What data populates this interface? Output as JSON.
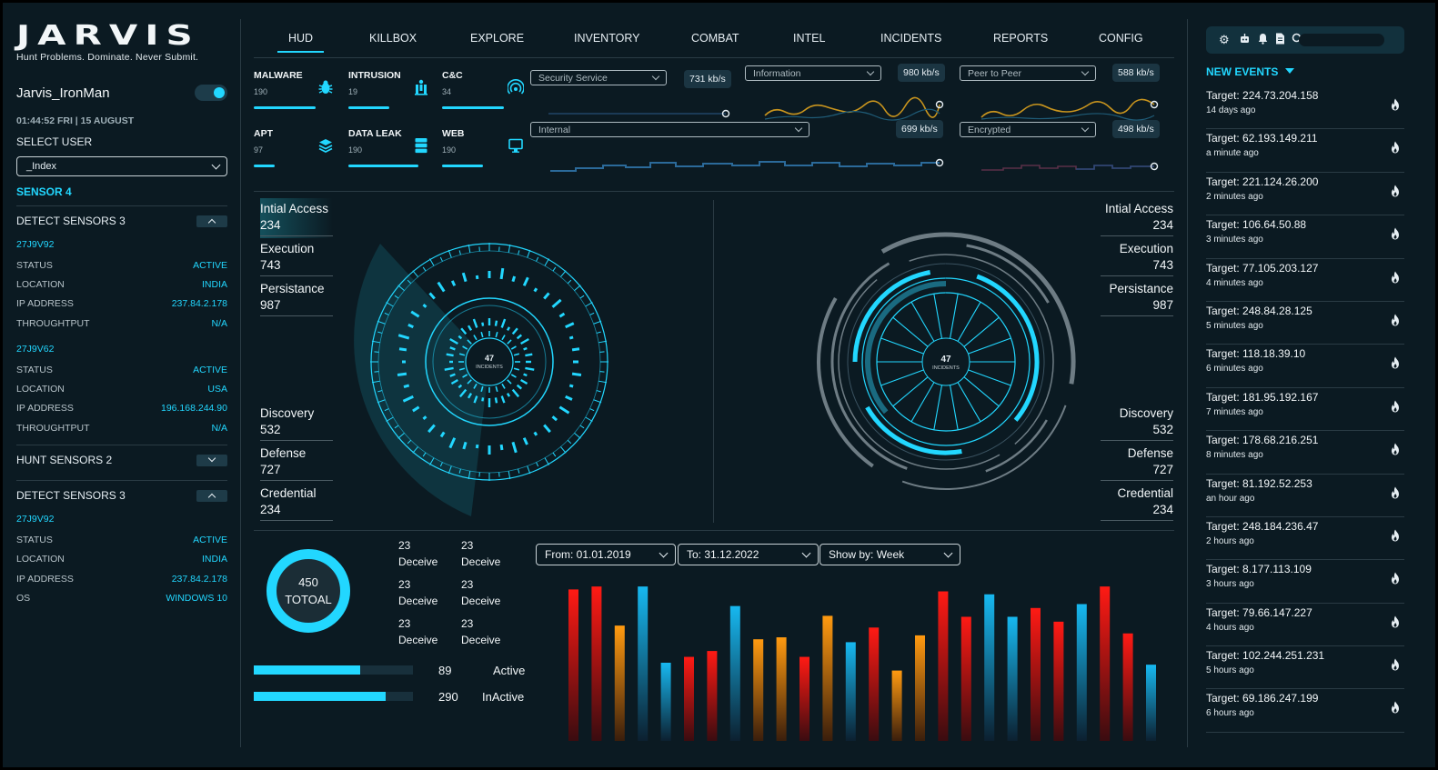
{
  "app": {
    "logo": "JARVIS",
    "tagline": "Hunt Problems. Dominate. Never Submit."
  },
  "user": {
    "name": "Jarvis_IronMan",
    "datetime": "01:44:52 FRI | 15 AUGUST",
    "select_label": "SELECT USER",
    "select_value": "_Index"
  },
  "sidebar": {
    "sensor_title": "SENSOR 4",
    "sections": [
      {
        "title": "DETECT SENSORS 3",
        "sensors": [
          {
            "id": "27J9V92",
            "rows": [
              {
                "k": "STATUS",
                "v": "ACTIVE"
              },
              {
                "k": "LOCATION",
                "v": "INDIA"
              },
              {
                "k": "IP ADDRESS",
                "v": "237.84.2.178"
              },
              {
                "k": "THROUGHTPUT",
                "v": "N/A"
              }
            ]
          },
          {
            "id": "27J9V62",
            "rows": [
              {
                "k": "STATUS",
                "v": "ACTIVE"
              },
              {
                "k": "LOCATION",
                "v": "USA"
              },
              {
                "k": "IP ADDRESS",
                "v": "196.168.244.90"
              },
              {
                "k": "THROUGHTPUT",
                "v": "N/A"
              }
            ]
          }
        ]
      },
      {
        "title": "HUNT SENSORS 2"
      },
      {
        "title": "DETECT SENSORS 3",
        "sensors": [
          {
            "id": "27J9V92",
            "rows": [
              {
                "k": "STATUS",
                "v": "ACTIVE"
              },
              {
                "k": "LOCATION",
                "v": "INDIA"
              },
              {
                "k": "IP ADDRESS",
                "v": "237.84.2.178"
              },
              {
                "k": "OS",
                "v": "WINDOWS 10"
              }
            ]
          }
        ]
      }
    ]
  },
  "nav": [
    "HUD",
    "KILLBOX",
    "EXPLORE",
    "INVENTORY",
    "COMBAT",
    "INTEL",
    "INCIDENTS",
    "REPORTS",
    "CONFIG"
  ],
  "threats": [
    {
      "name": "MALWARE",
      "count": "190",
      "icon": "bug-icon",
      "level": 0.75
    },
    {
      "name": "INTRUSION",
      "count": "19",
      "icon": "intrusion-icon",
      "level": 0.5
    },
    {
      "name": "C&C",
      "count": "34",
      "icon": "signal-icon",
      "level": 0.75
    },
    {
      "name": "APT",
      "count": "97",
      "icon": "layers-icon",
      "level": 0.25
    },
    {
      "name": "DATA LEAK",
      "count": "190",
      "icon": "database-icon",
      "level": 0.85
    },
    {
      "name": "WEB",
      "count": "190",
      "icon": "monitor-icon",
      "level": 0.5
    }
  ],
  "traffic": {
    "top": [
      {
        "label": "Security Service",
        "rate": "731 kb/s"
      },
      {
        "label": "Information",
        "rate": "980 kb/s"
      },
      {
        "label": "Peer to Peer",
        "rate": "588 kb/s"
      }
    ],
    "bottom": [
      {
        "label": "Internal",
        "rate": "699 kb/s"
      },
      {
        "label": "Encrypted",
        "rate": "498 kb/s"
      }
    ]
  },
  "tactics": {
    "top": [
      {
        "name": "Intial Access",
        "value": "234"
      },
      {
        "name": "Execution",
        "value": "743"
      },
      {
        "name": "Persistance",
        "value": "987"
      }
    ],
    "bottom": [
      {
        "name": "Discovery",
        "value": "532"
      },
      {
        "name": "Defense",
        "value": "727"
      },
      {
        "name": "Credential",
        "value": "234"
      }
    ]
  },
  "radar": {
    "count": "47",
    "label": "INCIDENTS"
  },
  "summary": {
    "total": "450",
    "total_label": "TOTOAL",
    "deceive": [
      {
        "n": "23",
        "label": "Deceive"
      },
      {
        "n": "23",
        "label": "Deceive"
      },
      {
        "n": "23",
        "label": "Deceive"
      },
      {
        "n": "23",
        "label": "Deceive"
      },
      {
        "n": "23",
        "label": "Deceive"
      },
      {
        "n": "23",
        "label": "Deceive"
      }
    ],
    "active": {
      "value": "89",
      "label": "Active",
      "level": 0.67
    },
    "inactive": {
      "value": "290",
      "label": "InActive",
      "level": 0.83
    }
  },
  "filters": {
    "from": "From: 01.01.2019",
    "to": "To: 31.12.2022",
    "show": "Show by: Week"
  },
  "chart_data": {
    "type": "bar",
    "ylim": [
      0,
      160
    ],
    "values": [
      155,
      158,
      118,
      158,
      80,
      86,
      92,
      138,
      104,
      106,
      86,
      128,
      101,
      116,
      72,
      108,
      153,
      127,
      150,
      127,
      136,
      122,
      140,
      158,
      110,
      78
    ],
    "colors": [
      "red",
      "red",
      "orange",
      "blue",
      "blue",
      "red",
      "red",
      "blue",
      "orange",
      "orange",
      "red",
      "orange",
      "blue",
      "red",
      "orange",
      "orange",
      "red",
      "red",
      "blue",
      "blue",
      "red",
      "red",
      "blue",
      "red",
      "red",
      "blue"
    ]
  },
  "events": {
    "title": "NEW EVENTS",
    "items": [
      {
        "target": "Target: 224.73.204.158",
        "time": "14 days ago"
      },
      {
        "target": "Target: 62.193.149.211",
        "time": "a minute ago"
      },
      {
        "target": "Target: 221.124.26.200",
        "time": "2 minutes ago"
      },
      {
        "target": "Target: 106.64.50.88",
        "time": "3 minutes ago"
      },
      {
        "target": "Target: 77.105.203.127",
        "time": "4 minutes ago"
      },
      {
        "target": "Target: 248.84.28.125",
        "time": "5 minutes ago"
      },
      {
        "target": "Target: 118.18.39.10",
        "time": "6 minutes ago"
      },
      {
        "target": "Target: 181.95.192.167",
        "time": "7 minutes ago"
      },
      {
        "target": "Target: 178.68.216.251",
        "time": "8 minutes ago"
      },
      {
        "target": "Target: 81.192.52.253",
        "time": "an hour ago"
      },
      {
        "target": "Target: 248.184.236.47",
        "time": "2 hours ago"
      },
      {
        "target": "Target: 8.177.113.109",
        "time": "3 hours ago"
      },
      {
        "target": "Target: 79.66.147.227",
        "time": "4 hours ago"
      },
      {
        "target": "Target: 102.244.251.231",
        "time": "5 hours ago"
      },
      {
        "target": "Target: 69.186.247.199",
        "time": "6 hours ago"
      }
    ]
  },
  "toolbar_icons": [
    "gear-icon",
    "robot-icon",
    "bell-icon",
    "document-icon",
    "search-icon"
  ]
}
